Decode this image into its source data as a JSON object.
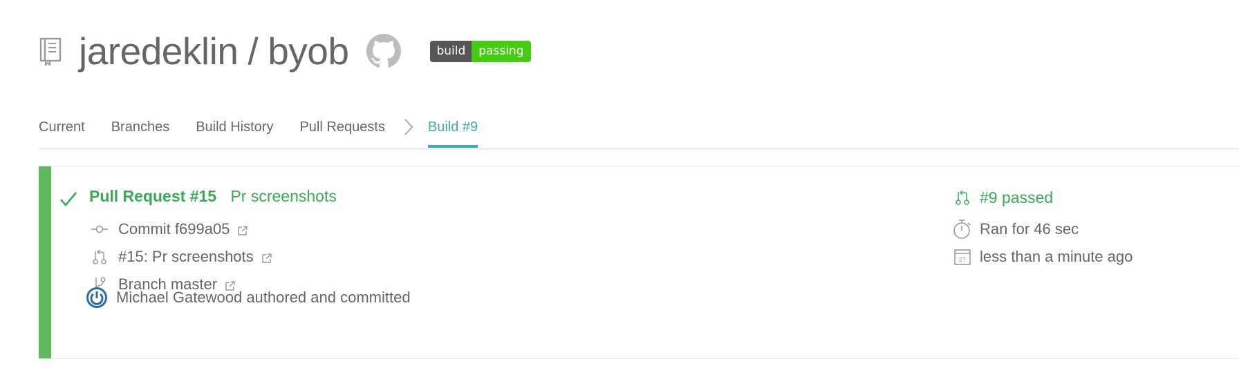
{
  "repo": {
    "owner": "jaredeklin",
    "separator": "/",
    "name": "byob",
    "badge": {
      "label": "build",
      "status": "passing",
      "label_color": "#555555",
      "status_color": "#44cc11"
    }
  },
  "tabs": [
    {
      "label": "Current"
    },
    {
      "label": "Branches"
    },
    {
      "label": "Build History"
    },
    {
      "label": "Pull Requests"
    },
    {
      "label": "Build #9",
      "active": true
    }
  ],
  "build": {
    "status_color": "#39aa56",
    "pr_number": "Pull Request #15",
    "pr_message": "Pr screenshots",
    "commit": "Commit f699a05",
    "pull_request": "#15: Pr screenshots",
    "branch": "Branch master",
    "author": "Michael Gatewood authored and committed",
    "summary": "#9 passed",
    "duration": "Ran for 46 sec",
    "finished": "less than a minute ago",
    "calendar_day": "27"
  },
  "icons": {
    "repo": "repo-book-icon",
    "github": "github-icon",
    "check": "check-icon",
    "commit": "commit-icon",
    "pull_request": "pull-request-icon",
    "branch": "branch-icon",
    "external": "external-link-icon",
    "stopwatch": "stopwatch-icon",
    "calendar": "calendar-icon",
    "avatar": "power-avatar-icon"
  }
}
